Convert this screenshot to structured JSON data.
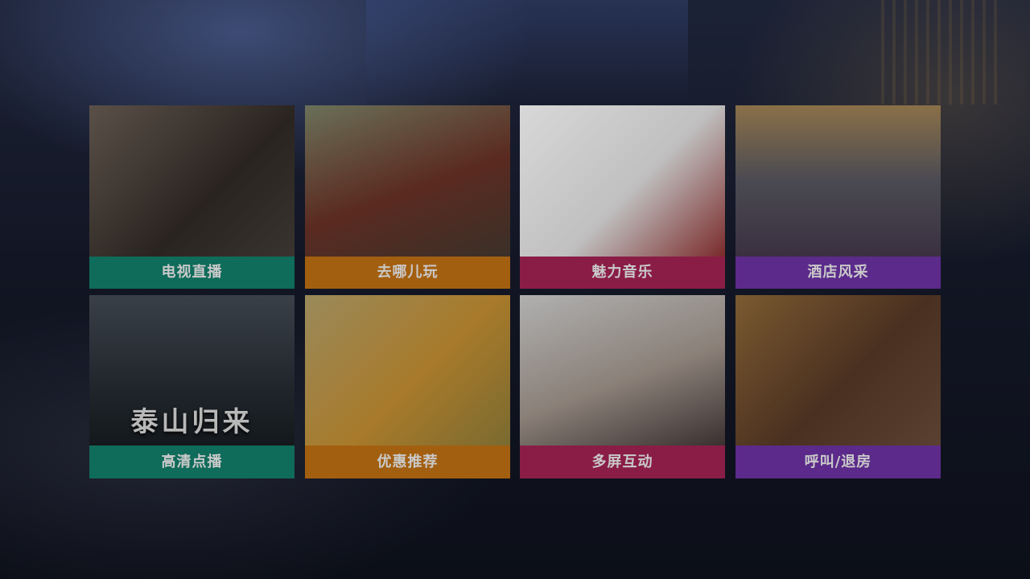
{
  "menu": {
    "tiles": [
      {
        "label": "电视直播",
        "color": "#0f6b5a",
        "photo_caption": ""
      },
      {
        "label": "去哪儿玩",
        "color": "#a35f10",
        "photo_caption": ""
      },
      {
        "label": "魅力音乐",
        "color": "#8a1d46",
        "photo_caption": ""
      },
      {
        "label": "酒店风采",
        "color": "#5b2a8a",
        "photo_caption": ""
      },
      {
        "label": "高清点播",
        "color": "#0f6b5a",
        "photo_caption": "泰山归来"
      },
      {
        "label": "优惠推荐",
        "color": "#a35f10",
        "photo_caption": ""
      },
      {
        "label": "多屏互动",
        "color": "#8a1d46",
        "photo_caption": ""
      },
      {
        "label": "呼叫/退房",
        "color": "#5b2a8a",
        "photo_caption": ""
      }
    ]
  }
}
